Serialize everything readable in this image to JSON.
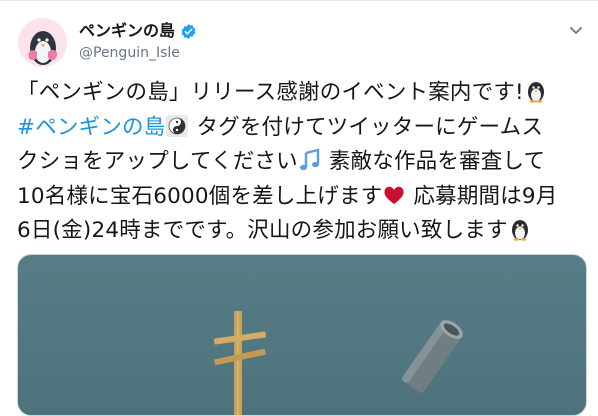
{
  "account": {
    "display_name": "ペンギンの島",
    "handle": "@Penguin_Isle",
    "verified": true
  },
  "tweet": {
    "line1": "「ペンギンの島」リリース感謝のイベント案内です!",
    "hashtag": "#ペンギンの島",
    "line2_rest": " タグを付けてツイッターにゲームス",
    "line3a": "クショをアップしてください",
    "line3b": " 素敵な作品を審査して",
    "line4a": "10名様に宝石6000個を差し上げます",
    "line4b": " 応募期間は9月",
    "line5": "6日(金)24時までです。沢山の参加お願い致します"
  },
  "icons": {
    "verified": "verified-badge-icon",
    "menu": "chevron-down-icon",
    "emojis": [
      "penguin-emoji-icon",
      "yin-yang-emoji-icon",
      "music-note-emoji-icon",
      "red-heart-emoji-icon",
      "penguin-emoji-icon"
    ]
  },
  "colors": {
    "link": "#1b95e0",
    "text": "#14171a",
    "secondary": "#657786",
    "media_bg": "#557c84"
  }
}
